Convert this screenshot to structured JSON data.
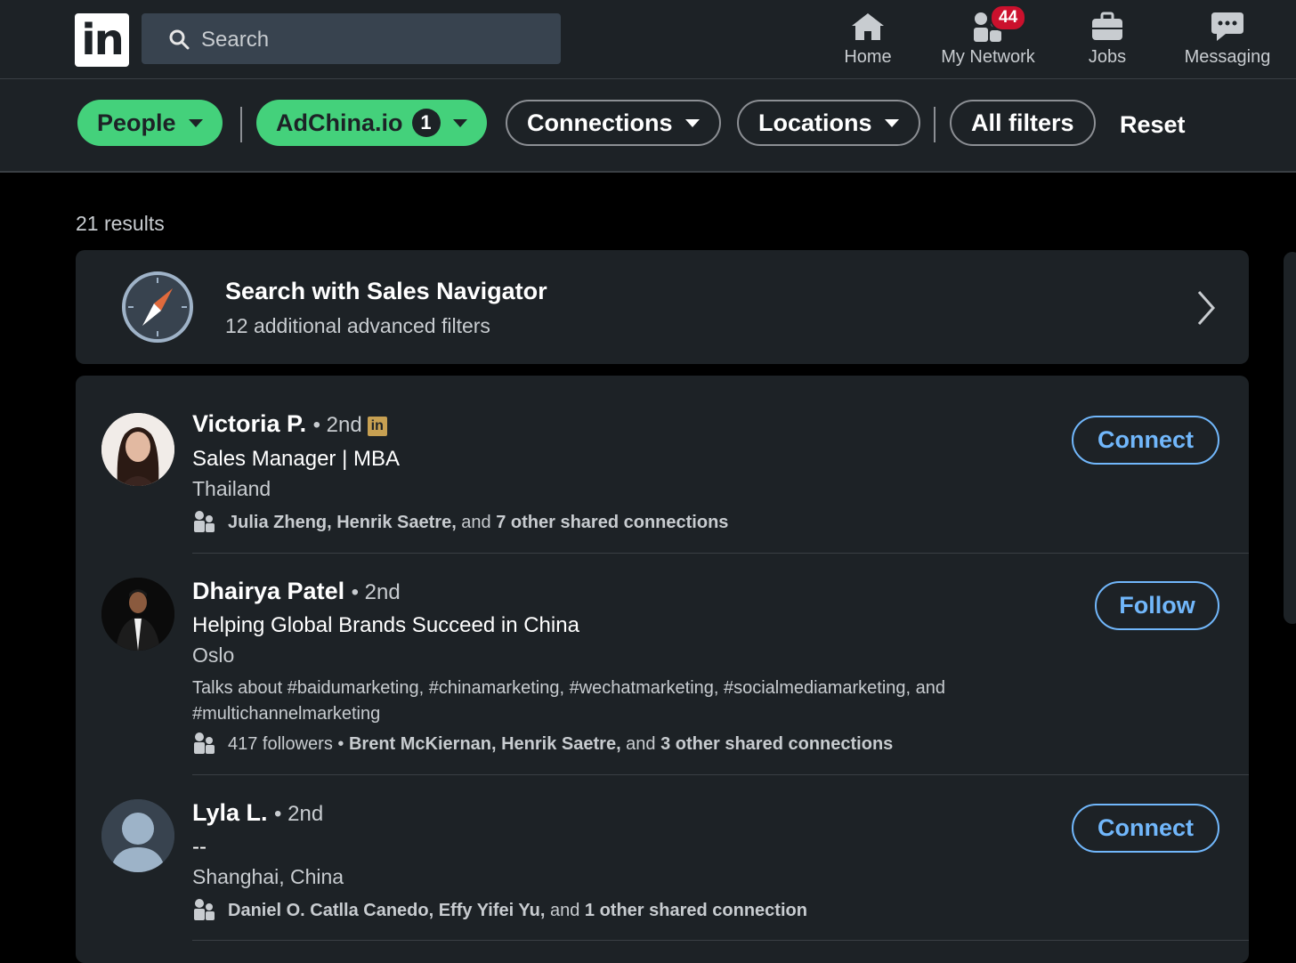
{
  "nav": {
    "logo_text": "in",
    "search_placeholder": "Search",
    "items": [
      {
        "label": "Home",
        "icon": "home-icon"
      },
      {
        "label": "My Network",
        "icon": "network-icon",
        "badge": "44"
      },
      {
        "label": "Jobs",
        "icon": "briefcase-icon"
      },
      {
        "label": "Messaging",
        "icon": "messaging-icon"
      }
    ]
  },
  "filters": {
    "people": "People",
    "company": "AdChina.io",
    "company_count": "1",
    "connections": "Connections",
    "locations": "Locations",
    "all_filters": "All filters",
    "reset": "Reset"
  },
  "results_count": "21 results",
  "sales_nav": {
    "title": "Search with Sales Navigator",
    "subtitle": "12 additional advanced filters"
  },
  "results": [
    {
      "name": "Victoria P.",
      "degree": "• 2nd",
      "headline": "Sales Manager | MBA",
      "location": "Thailand",
      "shared_names": "Julia Zheng, Henrik Saetre,",
      "shared_and": " and ",
      "shared_other": "7 other shared connections",
      "action": "Connect"
    },
    {
      "name": "Dhairya Patel",
      "degree": "• 2nd",
      "headline": "Helping Global Brands Succeed in China",
      "location": "Oslo",
      "talks": "Talks about #baidumarketing, #chinamarketing, #wechatmarketing, #socialmediamarketing, and #multichannelmarketing",
      "followers": "417 followers",
      "sep": " • ",
      "shared_names": "Brent McKiernan, Henrik Saetre,",
      "shared_and": " and ",
      "shared_other": "3 other shared connections",
      "action": "Follow"
    },
    {
      "name": "Lyla L.",
      "degree": "• 2nd",
      "headline": "--",
      "location": "Shanghai, China",
      "shared_names": "Daniel O. Catlla Canedo, Effy Yifei Yu,",
      "shared_and": " and ",
      "shared_other": "1 other shared connection",
      "action": "Connect"
    }
  ],
  "colors": {
    "surface": "#1d2226",
    "filter_active": "#44d17b",
    "link_blue": "#71b7fb",
    "badge_red": "#cb112d",
    "premium_gold": "#c7a052"
  }
}
